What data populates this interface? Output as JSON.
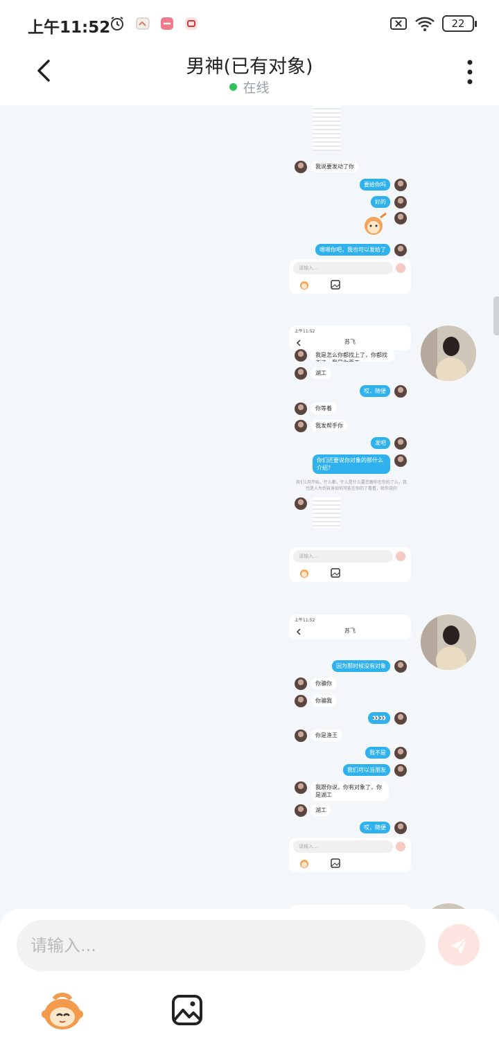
{
  "status_bar": {
    "time": "上午11:52",
    "battery": "22"
  },
  "header": {
    "title": "男神(已有对象)",
    "status": "在线"
  },
  "shots": [
    {
      "rows": [
        {
          "dir": "in",
          "text": "我说要发动了你"
        },
        {
          "dir": "out",
          "text": "要给你吗"
        },
        {
          "dir": "out",
          "text": "好的"
        },
        {
          "dir": "sticker"
        },
        {
          "dir": "out",
          "text": "嗯嗯你吧，我也可以发给了"
        }
      ],
      "input_placeholder": "请输入..."
    },
    {
      "title": "苏飞",
      "rows": [
        {
          "dir": "in",
          "text": "我是怎么你都找上了，你都找不了，我是你要工"
        },
        {
          "dir": "in",
          "text": "湖工"
        },
        {
          "dir": "out",
          "text": "哎，随便"
        },
        {
          "dir": "in",
          "text": "你等着"
        },
        {
          "dir": "in",
          "text": "我发帮手你"
        },
        {
          "dir": "out",
          "text": "发吧"
        },
        {
          "dir": "out",
          "text": "你们还要说你对象的那什么介绍?"
        },
        {
          "dir": "note",
          "text": "我们1月开始，什么都，什么是什么要您跟你在你的了么，我也是人为到自身如何可能在你的了看看，就你说的"
        },
        {
          "dir": "in",
          "text": ""
        }
      ],
      "input_placeholder": "请输入..."
    },
    {
      "title": "苏飞",
      "rows": [
        {
          "dir": "out",
          "text": "因为那时候没有对象"
        },
        {
          "dir": "in",
          "text": "你骗你"
        },
        {
          "dir": "in",
          "text": "你骗我"
        },
        {
          "dir": "out",
          "text": "👀👀"
        },
        {
          "dir": "in",
          "text": "你是渔王"
        },
        {
          "dir": "out",
          "text": "我不是"
        },
        {
          "dir": "out",
          "text": "我们可以当朋友"
        },
        {
          "dir": "in",
          "text": "我跟你说，你有对象了，你是湖工"
        },
        {
          "dir": "in",
          "text": "湖工"
        },
        {
          "dir": "out",
          "text": "哎，随便"
        }
      ],
      "input_placeholder": "请输入..."
    }
  ],
  "composer": {
    "placeholder": "请输入..."
  },
  "icons": {
    "back": "back-arrow-icon",
    "more": "more-vertical-icon",
    "send": "send-icon",
    "emoji": "monkey-sticker-icon",
    "image": "image-icon"
  },
  "colors": {
    "accent_blue": "#2fb1ee",
    "online_green": "#2ec45a",
    "send_pink": "#fde4e1",
    "background": "#f4f7fa"
  }
}
